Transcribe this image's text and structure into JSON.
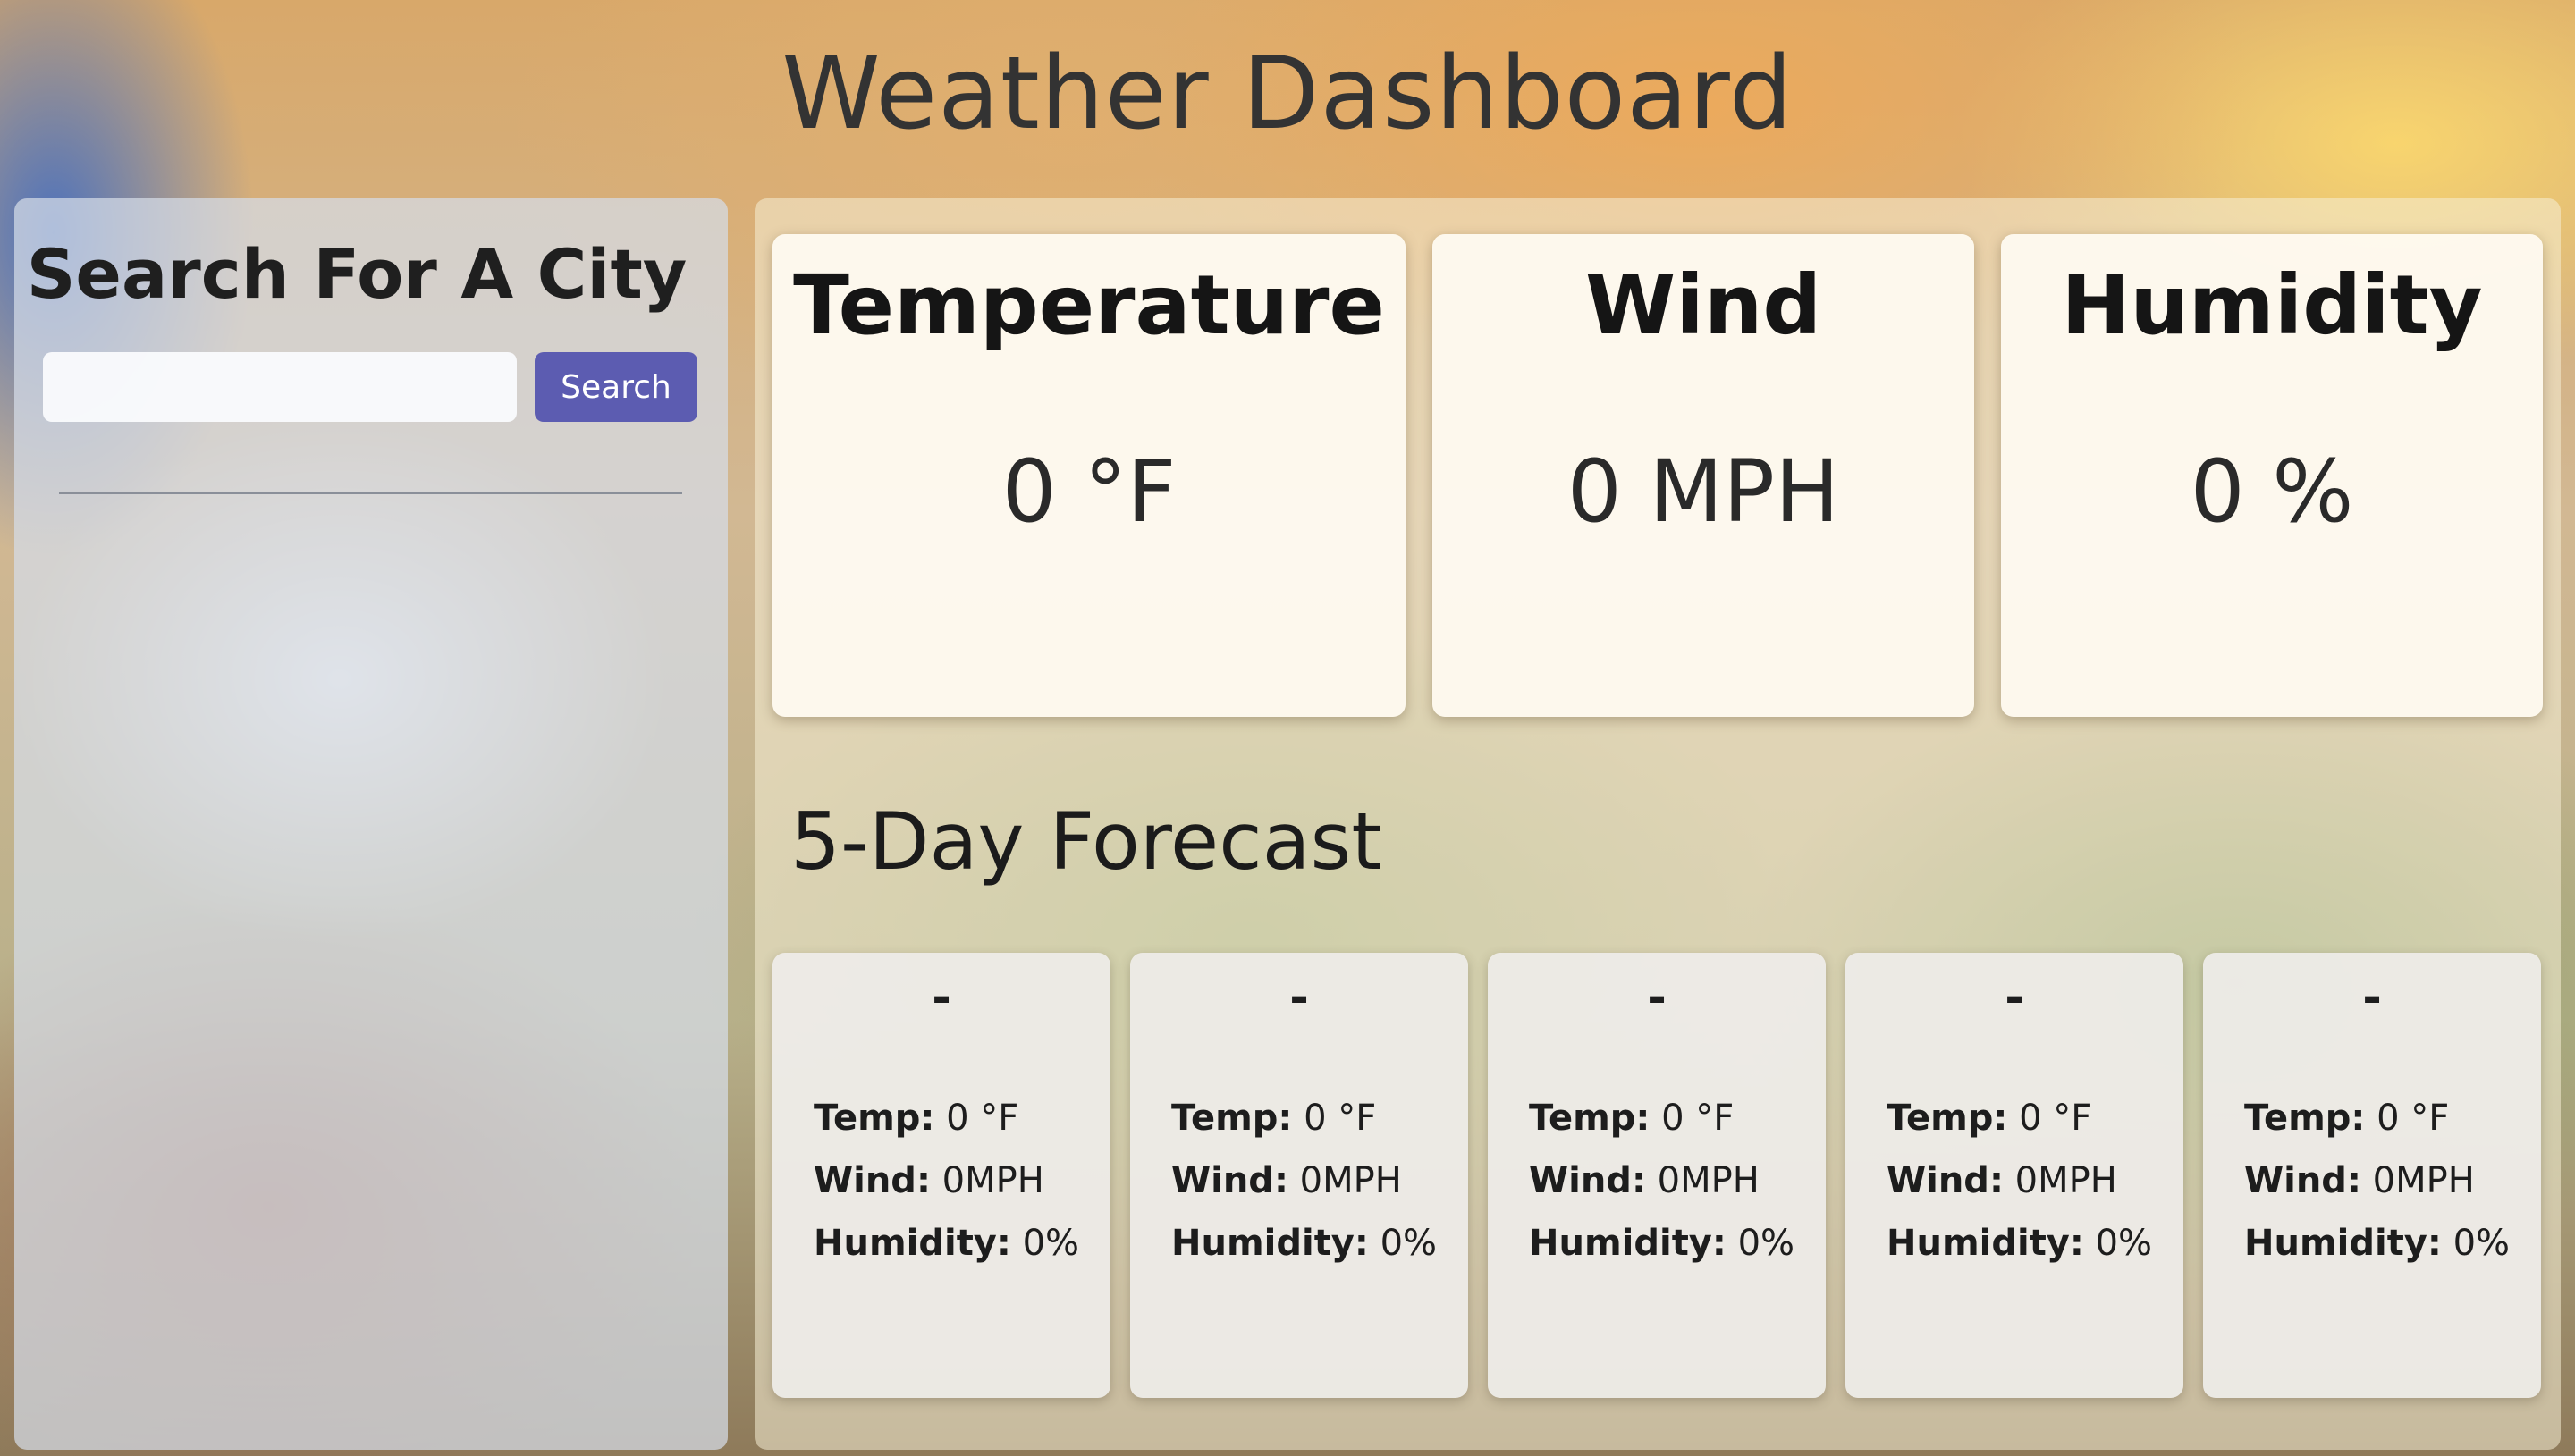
{
  "header": {
    "title": "Weather Dashboard"
  },
  "sidebar": {
    "title": "Search For A City",
    "search_placeholder": "",
    "search_value": "",
    "search_button": "Search"
  },
  "current": {
    "temperature": {
      "label": "Temperature",
      "value": "0 °F"
    },
    "wind": {
      "label": "Wind",
      "value": "0 MPH"
    },
    "humidity": {
      "label": "Humidity",
      "value": "0 %"
    }
  },
  "forecast": {
    "heading": "5-Day Forecast",
    "temp_label": "Temp:",
    "wind_label": "Wind:",
    "humidity_label": "Humidity:",
    "days": [
      {
        "date": "-",
        "temp": "0 °F",
        "wind": "0MPH",
        "humidity": "0%"
      },
      {
        "date": "-",
        "temp": "0 °F",
        "wind": "0MPH",
        "humidity": "0%"
      },
      {
        "date": "-",
        "temp": "0 °F",
        "wind": "0MPH",
        "humidity": "0%"
      },
      {
        "date": "-",
        "temp": "0 °F",
        "wind": "0MPH",
        "humidity": "0%"
      },
      {
        "date": "-",
        "temp": "0 °F",
        "wind": "0MPH",
        "humidity": "0%"
      }
    ]
  },
  "colors": {
    "search_button": "#5c5cb1",
    "title_text": "#333333"
  }
}
